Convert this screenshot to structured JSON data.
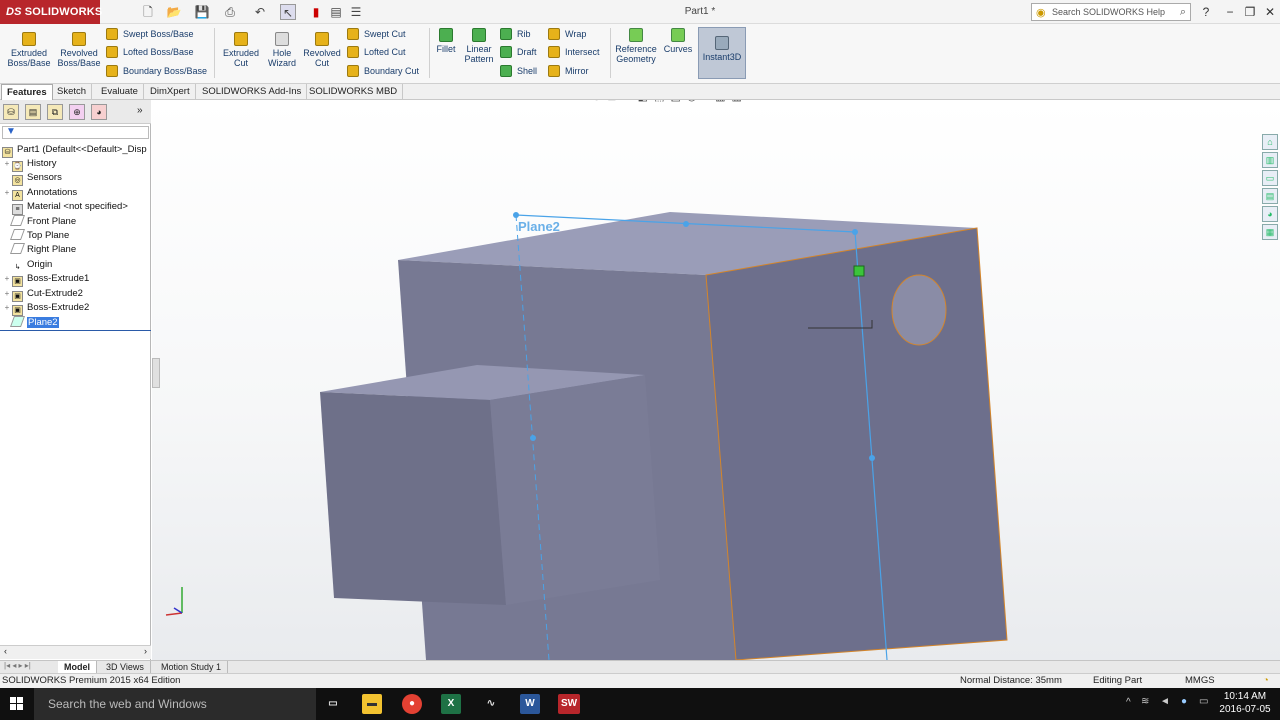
{
  "titlebar": {
    "app": "SOLIDWORKS",
    "doc_title": "Part1 *",
    "search_placeholder": "Search SOLIDWORKS Help",
    "help": "?",
    "minimize": "−",
    "restore": "❐",
    "close": "✕"
  },
  "ribbon": {
    "extruded_boss": "Extruded\nBoss/Base",
    "revolved_boss": "Revolved\nBoss/Base",
    "swept_boss": "Swept Boss/Base",
    "lofted_boss": "Lofted Boss/Base",
    "boundary_boss": "Boundary Boss/Base",
    "extruded_cut": "Extruded\nCut",
    "hole_wizard": "Hole\nWizard",
    "revolved_cut": "Revolved\nCut",
    "swept_cut": "Swept Cut",
    "lofted_cut": "Lofted Cut",
    "boundary_cut": "Boundary Cut",
    "fillet": "Fillet",
    "linear_pattern": "Linear\nPattern",
    "rib": "Rib",
    "draft": "Draft",
    "shell": "Shell",
    "wrap": "Wrap",
    "intersect": "Intersect",
    "mirror": "Mirror",
    "reference_geometry": "Reference\nGeometry",
    "curves": "Curves",
    "instant3d": "Instant3D"
  },
  "tabs": [
    "Features",
    "Sketch",
    "Evaluate",
    "DimXpert",
    "SOLIDWORKS Add-Ins",
    "SOLIDWORKS MBD"
  ],
  "tree": {
    "root": "Part1  (Default<<Default>_Disp",
    "items": [
      "History",
      "Sensors",
      "Annotations",
      "Material <not specified>",
      "Front Plane",
      "Top Plane",
      "Right Plane",
      "Origin",
      "Boss-Extrude1",
      "Cut-Extrude2",
      "Boss-Extrude2",
      "Plane2"
    ]
  },
  "viewport": {
    "plane_label": "Plane2"
  },
  "bottom_tabs": [
    "Model",
    "3D Views",
    "Motion Study 1"
  ],
  "status": {
    "edition": "SOLIDWORKS Premium 2015 x64 Edition",
    "distance": "Normal Distance: 35mm",
    "mode": "Editing Part",
    "units": "MMGS"
  },
  "taskbar": {
    "search": "Search the web and Windows",
    "time": "10:14 AM",
    "date": "2016-07-05"
  }
}
